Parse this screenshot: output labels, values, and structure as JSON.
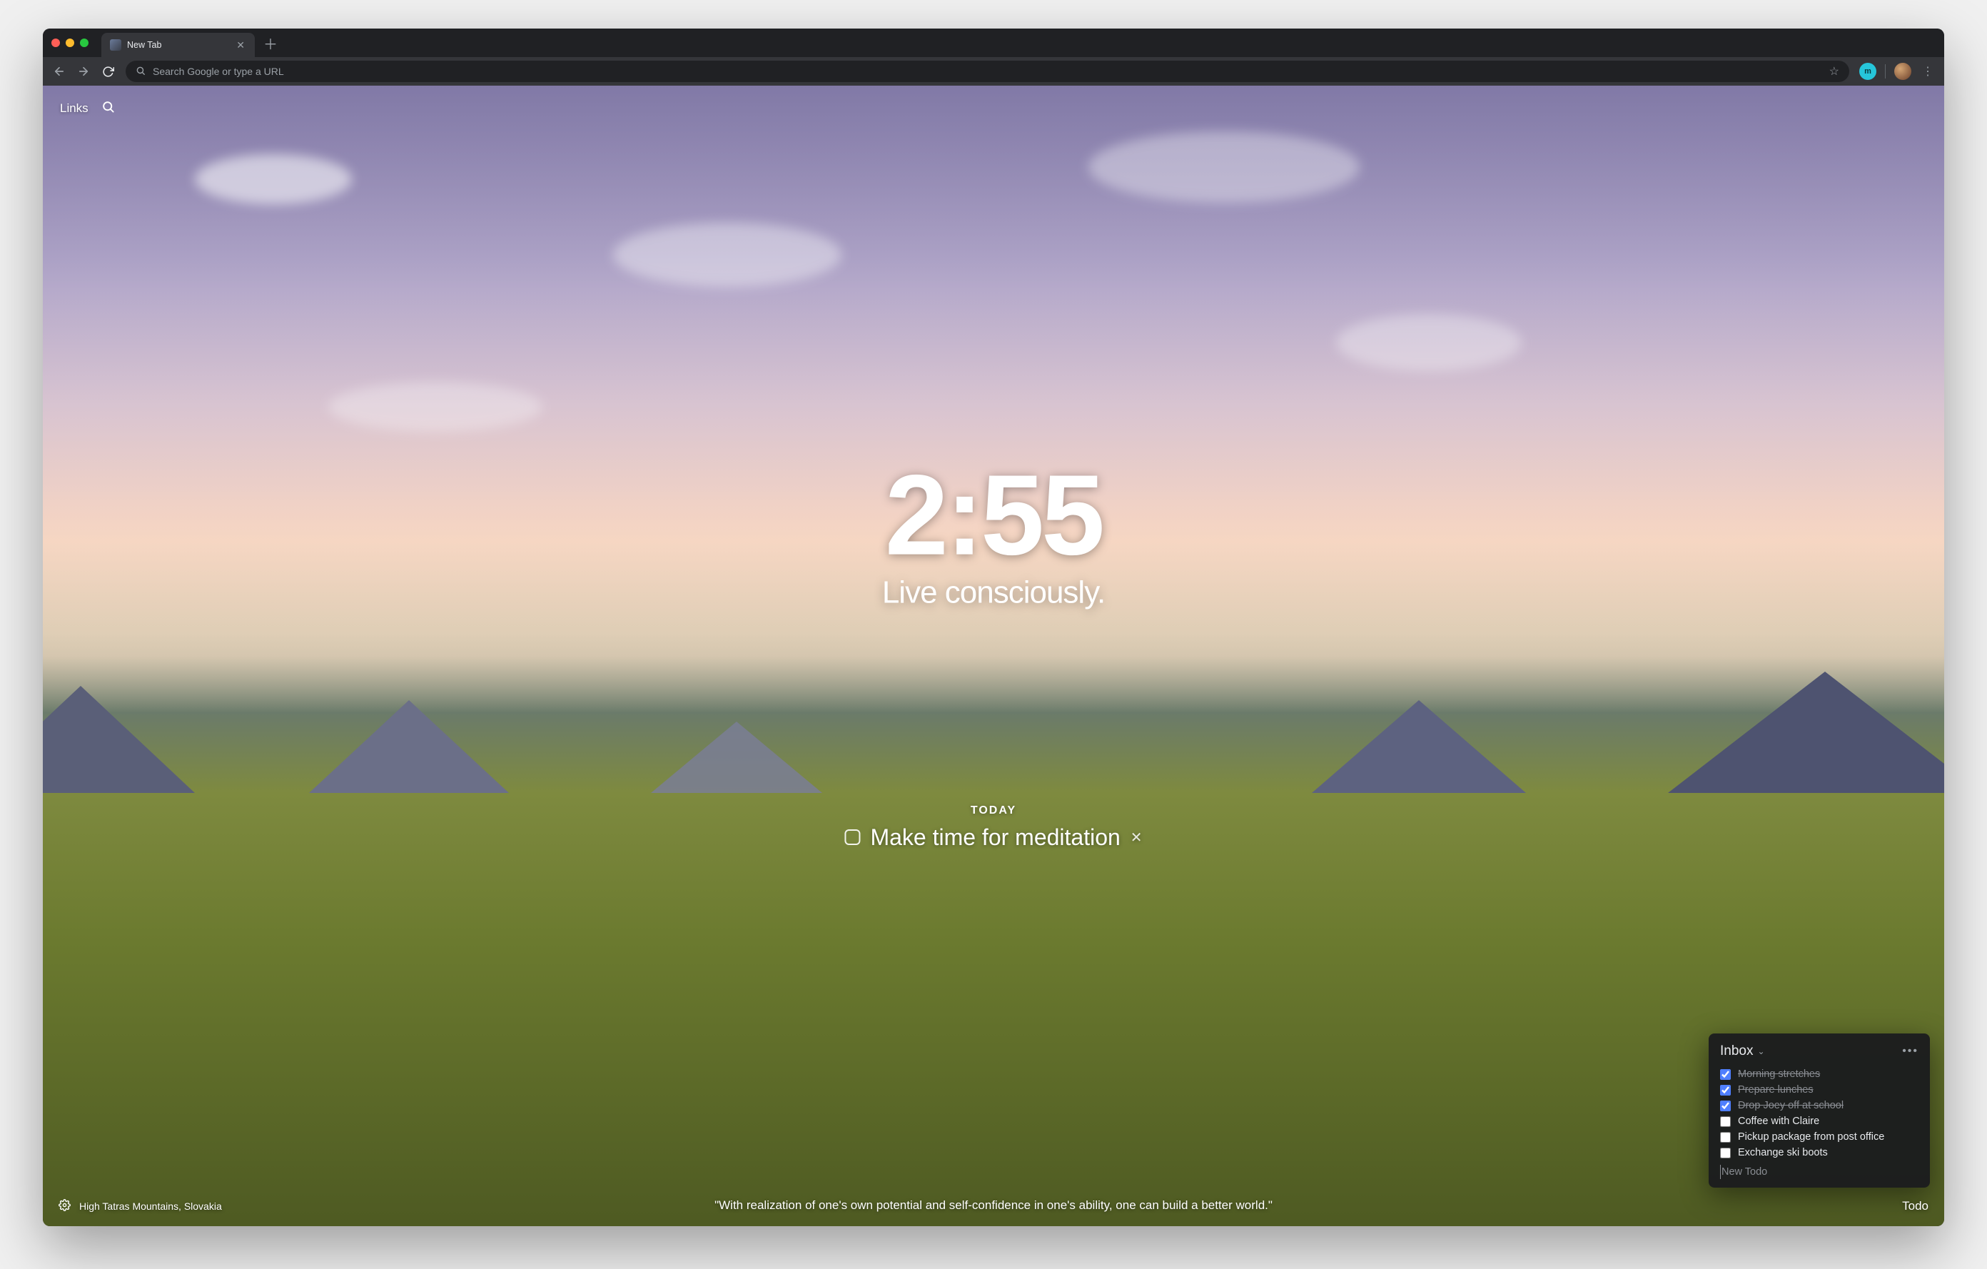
{
  "browser": {
    "tab_title": "New Tab",
    "omnibox_placeholder": "Search Google or type a URL",
    "profile_initial": "m"
  },
  "topbar": {
    "links_label": "Links"
  },
  "clock": {
    "time": "2:55",
    "mantra": "Live consciously."
  },
  "focus": {
    "label": "TODAY",
    "text": "Make time for meditation"
  },
  "photo": {
    "location": "High Tatras Mountains, Slovakia"
  },
  "quote": {
    "text": "\"With realization of one's own potential and self-confidence in one's ability, one can build a better world.\""
  },
  "todo": {
    "button_label": "Todo",
    "panel_title": "Inbox",
    "new_placeholder": "New Todo",
    "items": [
      {
        "label": "Morning stretches",
        "done": true
      },
      {
        "label": "Prepare lunches",
        "done": true
      },
      {
        "label": "Drop Joey off at school",
        "done": true
      },
      {
        "label": "Coffee with Claire",
        "done": false
      },
      {
        "label": "Pickup package from post office",
        "done": false
      },
      {
        "label": "Exchange ski boots",
        "done": false
      }
    ]
  }
}
